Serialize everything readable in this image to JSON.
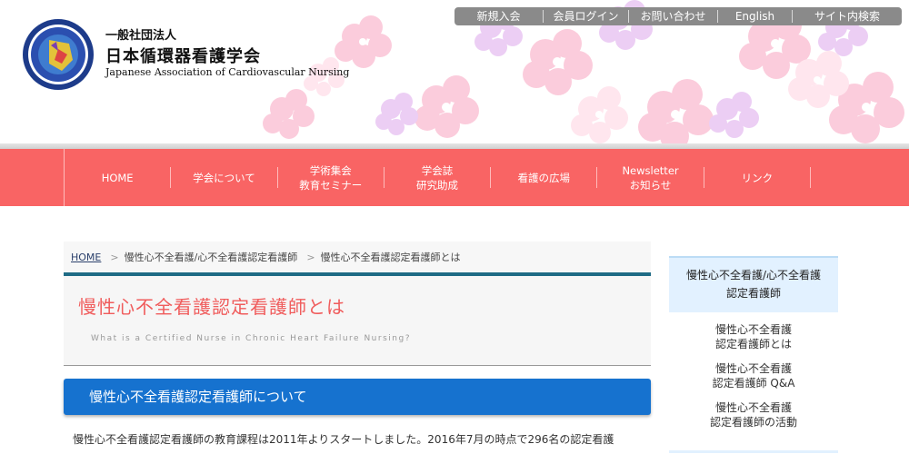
{
  "header": {
    "logo_text": "Association of Cardiovascular Nursing",
    "org_type": "一般社団法人",
    "org_name": "日本循環器看護学会",
    "org_name_en": "Japanese Association of Cardiovascular Nursing"
  },
  "topnav": {
    "items": [
      {
        "label": "新規入会"
      },
      {
        "label": "会員ログイン"
      },
      {
        "label": "お問い合わせ"
      },
      {
        "label": "English"
      },
      {
        "label": "サイト内検索"
      }
    ]
  },
  "mainnav": {
    "items": [
      {
        "line1": "HOME",
        "line2": ""
      },
      {
        "line1": "学会について",
        "line2": ""
      },
      {
        "line1": "学術集会",
        "line2": "教育セミナー"
      },
      {
        "line1": "学会誌",
        "line2": "研究助成"
      },
      {
        "line1": "看護の広場",
        "line2": ""
      },
      {
        "line1": "Newsletter",
        "line2": "お知らせ"
      },
      {
        "line1": "リンク",
        "line2": ""
      }
    ]
  },
  "breadcrumb": {
    "home": "HOME",
    "level1": "慢性心不全看護/心不全看護認定看護師",
    "level2": "慢性心不全看護認定看護師とは"
  },
  "page": {
    "title": "慢性心不全看護認定看護師とは",
    "subtitle": "What is a Certified Nurse in Chronic Heart Failure Nursing?",
    "section_heading": "慢性心不全看護認定看護師について",
    "body": "慢性心不全看護認定看護師の教育課程は2011年よりスタートしました。2016年7月の時点で296名の認定看護"
  },
  "sidebar": {
    "heading_line1": "慢性心不全看護/心不全看護",
    "heading_line2": "認定看護師",
    "items": [
      {
        "line1": "慢性心不全看護",
        "line2": "認定看護師とは"
      },
      {
        "line1": "慢性心不全看護",
        "line2": "認定看護師 Q&A"
      },
      {
        "line1": "慢性心不全看護",
        "line2": "認定看護師の活動"
      }
    ]
  },
  "colors": {
    "nav_red": "#f96464",
    "title_red": "#f05c5c",
    "section_blue": "#1672cf",
    "sidebar_blue": "#e2f1ff"
  }
}
